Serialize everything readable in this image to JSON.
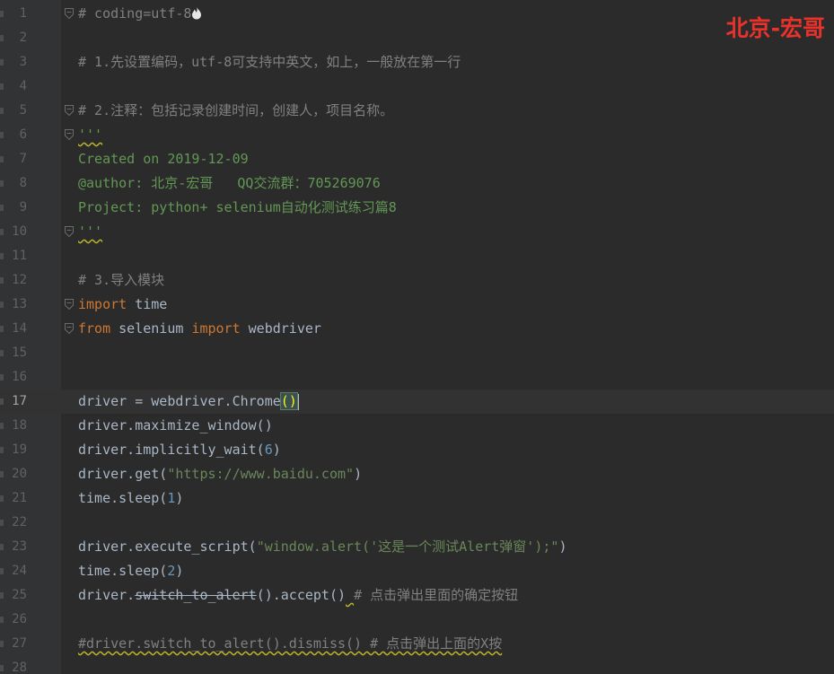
{
  "watermark": "北京-宏哥",
  "current_line": 17,
  "lines": [
    {
      "n": "1",
      "segments": [
        [
          "cm",
          "# coding=utf-8"
        ]
      ],
      "fold": true,
      "flame": true
    },
    {
      "n": "2",
      "segments": []
    },
    {
      "n": "3",
      "segments": [
        [
          "cm",
          "# 1.先设置编码，utf-8可支持中英文，如上，一般放在第一行"
        ]
      ]
    },
    {
      "n": "4",
      "segments": []
    },
    {
      "n": "5",
      "segments": [
        [
          "cm",
          "# 2.注释：包括记录创建时间，创建人，项目名称。"
        ]
      ],
      "fold": true
    },
    {
      "n": "6",
      "segments": [
        [
          "doc squiggle",
          "'''"
        ]
      ],
      "fold": true
    },
    {
      "n": "7",
      "segments": [
        [
          "doc",
          "Created on 2019-12-09"
        ]
      ]
    },
    {
      "n": "8",
      "segments": [
        [
          "doc",
          "@author: 北京-宏哥   QQ交流群：705269076"
        ]
      ]
    },
    {
      "n": "9",
      "segments": [
        [
          "doc",
          "Project: python+ selenium自动化测试练习篇8"
        ]
      ]
    },
    {
      "n": "10",
      "segments": [
        [
          "doc squiggle",
          "'''"
        ]
      ],
      "fold": true
    },
    {
      "n": "11",
      "segments": []
    },
    {
      "n": "12",
      "segments": [
        [
          "cm",
          "# 3.导入模块"
        ]
      ]
    },
    {
      "n": "13",
      "segments": [
        [
          "kw",
          "import"
        ],
        [
          "",
          " time"
        ]
      ],
      "fold": true
    },
    {
      "n": "14",
      "segments": [
        [
          "kw",
          "from"
        ],
        [
          "",
          " selenium "
        ],
        [
          "kw",
          "import"
        ],
        [
          "",
          " webdriver"
        ]
      ],
      "fold": true
    },
    {
      "n": "15",
      "segments": []
    },
    {
      "n": "16",
      "segments": []
    },
    {
      "n": "17",
      "segments": [
        [
          "",
          "driver = webdriver.Chrome"
        ],
        [
          "paren-hl",
          "()"
        ]
      ],
      "caret": true
    },
    {
      "n": "18",
      "segments": [
        [
          "",
          "driver.maximize_window()"
        ]
      ]
    },
    {
      "n": "19",
      "segments": [
        [
          "",
          "driver.implicitly_wait("
        ],
        [
          "num",
          "6"
        ],
        [
          "",
          ")"
        ]
      ]
    },
    {
      "n": "20",
      "segments": [
        [
          "",
          "driver.get("
        ],
        [
          "str",
          "\"https://www.baidu.com\""
        ],
        [
          "",
          ")"
        ]
      ]
    },
    {
      "n": "21",
      "segments": [
        [
          "",
          "time.sleep("
        ],
        [
          "num",
          "1"
        ],
        [
          "",
          ")"
        ]
      ]
    },
    {
      "n": "22",
      "segments": []
    },
    {
      "n": "23",
      "segments": [
        [
          "",
          "driver.execute_script("
        ],
        [
          "str",
          "\"window.alert('这是一个测试Alert弹窗');\""
        ],
        [
          "",
          ")"
        ]
      ]
    },
    {
      "n": "24",
      "segments": [
        [
          "",
          "time.sleep("
        ],
        [
          "num",
          "2"
        ],
        [
          "",
          ")"
        ]
      ]
    },
    {
      "n": "25",
      "segments": [
        [
          "",
          "driver."
        ],
        [
          "strike",
          "switch_to_alert"
        ],
        [
          "",
          "().accept()"
        ],
        [
          "squiggle",
          " "
        ],
        [
          "cm",
          "# 点击弹出里面的确定按钮"
        ]
      ]
    },
    {
      "n": "26",
      "segments": []
    },
    {
      "n": "27",
      "segments": [
        [
          "cm squiggle",
          "#driver.switch_to_alert().dismiss() # 点击弹出上面的X按"
        ]
      ]
    },
    {
      "n": "28",
      "segments": []
    }
  ],
  "colors": {
    "background": "#2b2b2b",
    "comment": "#808080",
    "docstring": "#629755",
    "keyword": "#cc7832",
    "number": "#6897bb",
    "string": "#6a8759",
    "watermark": "#e8322b"
  },
  "icons": {
    "fold": "fold-marker-icon",
    "flame": "flame-icon"
  }
}
